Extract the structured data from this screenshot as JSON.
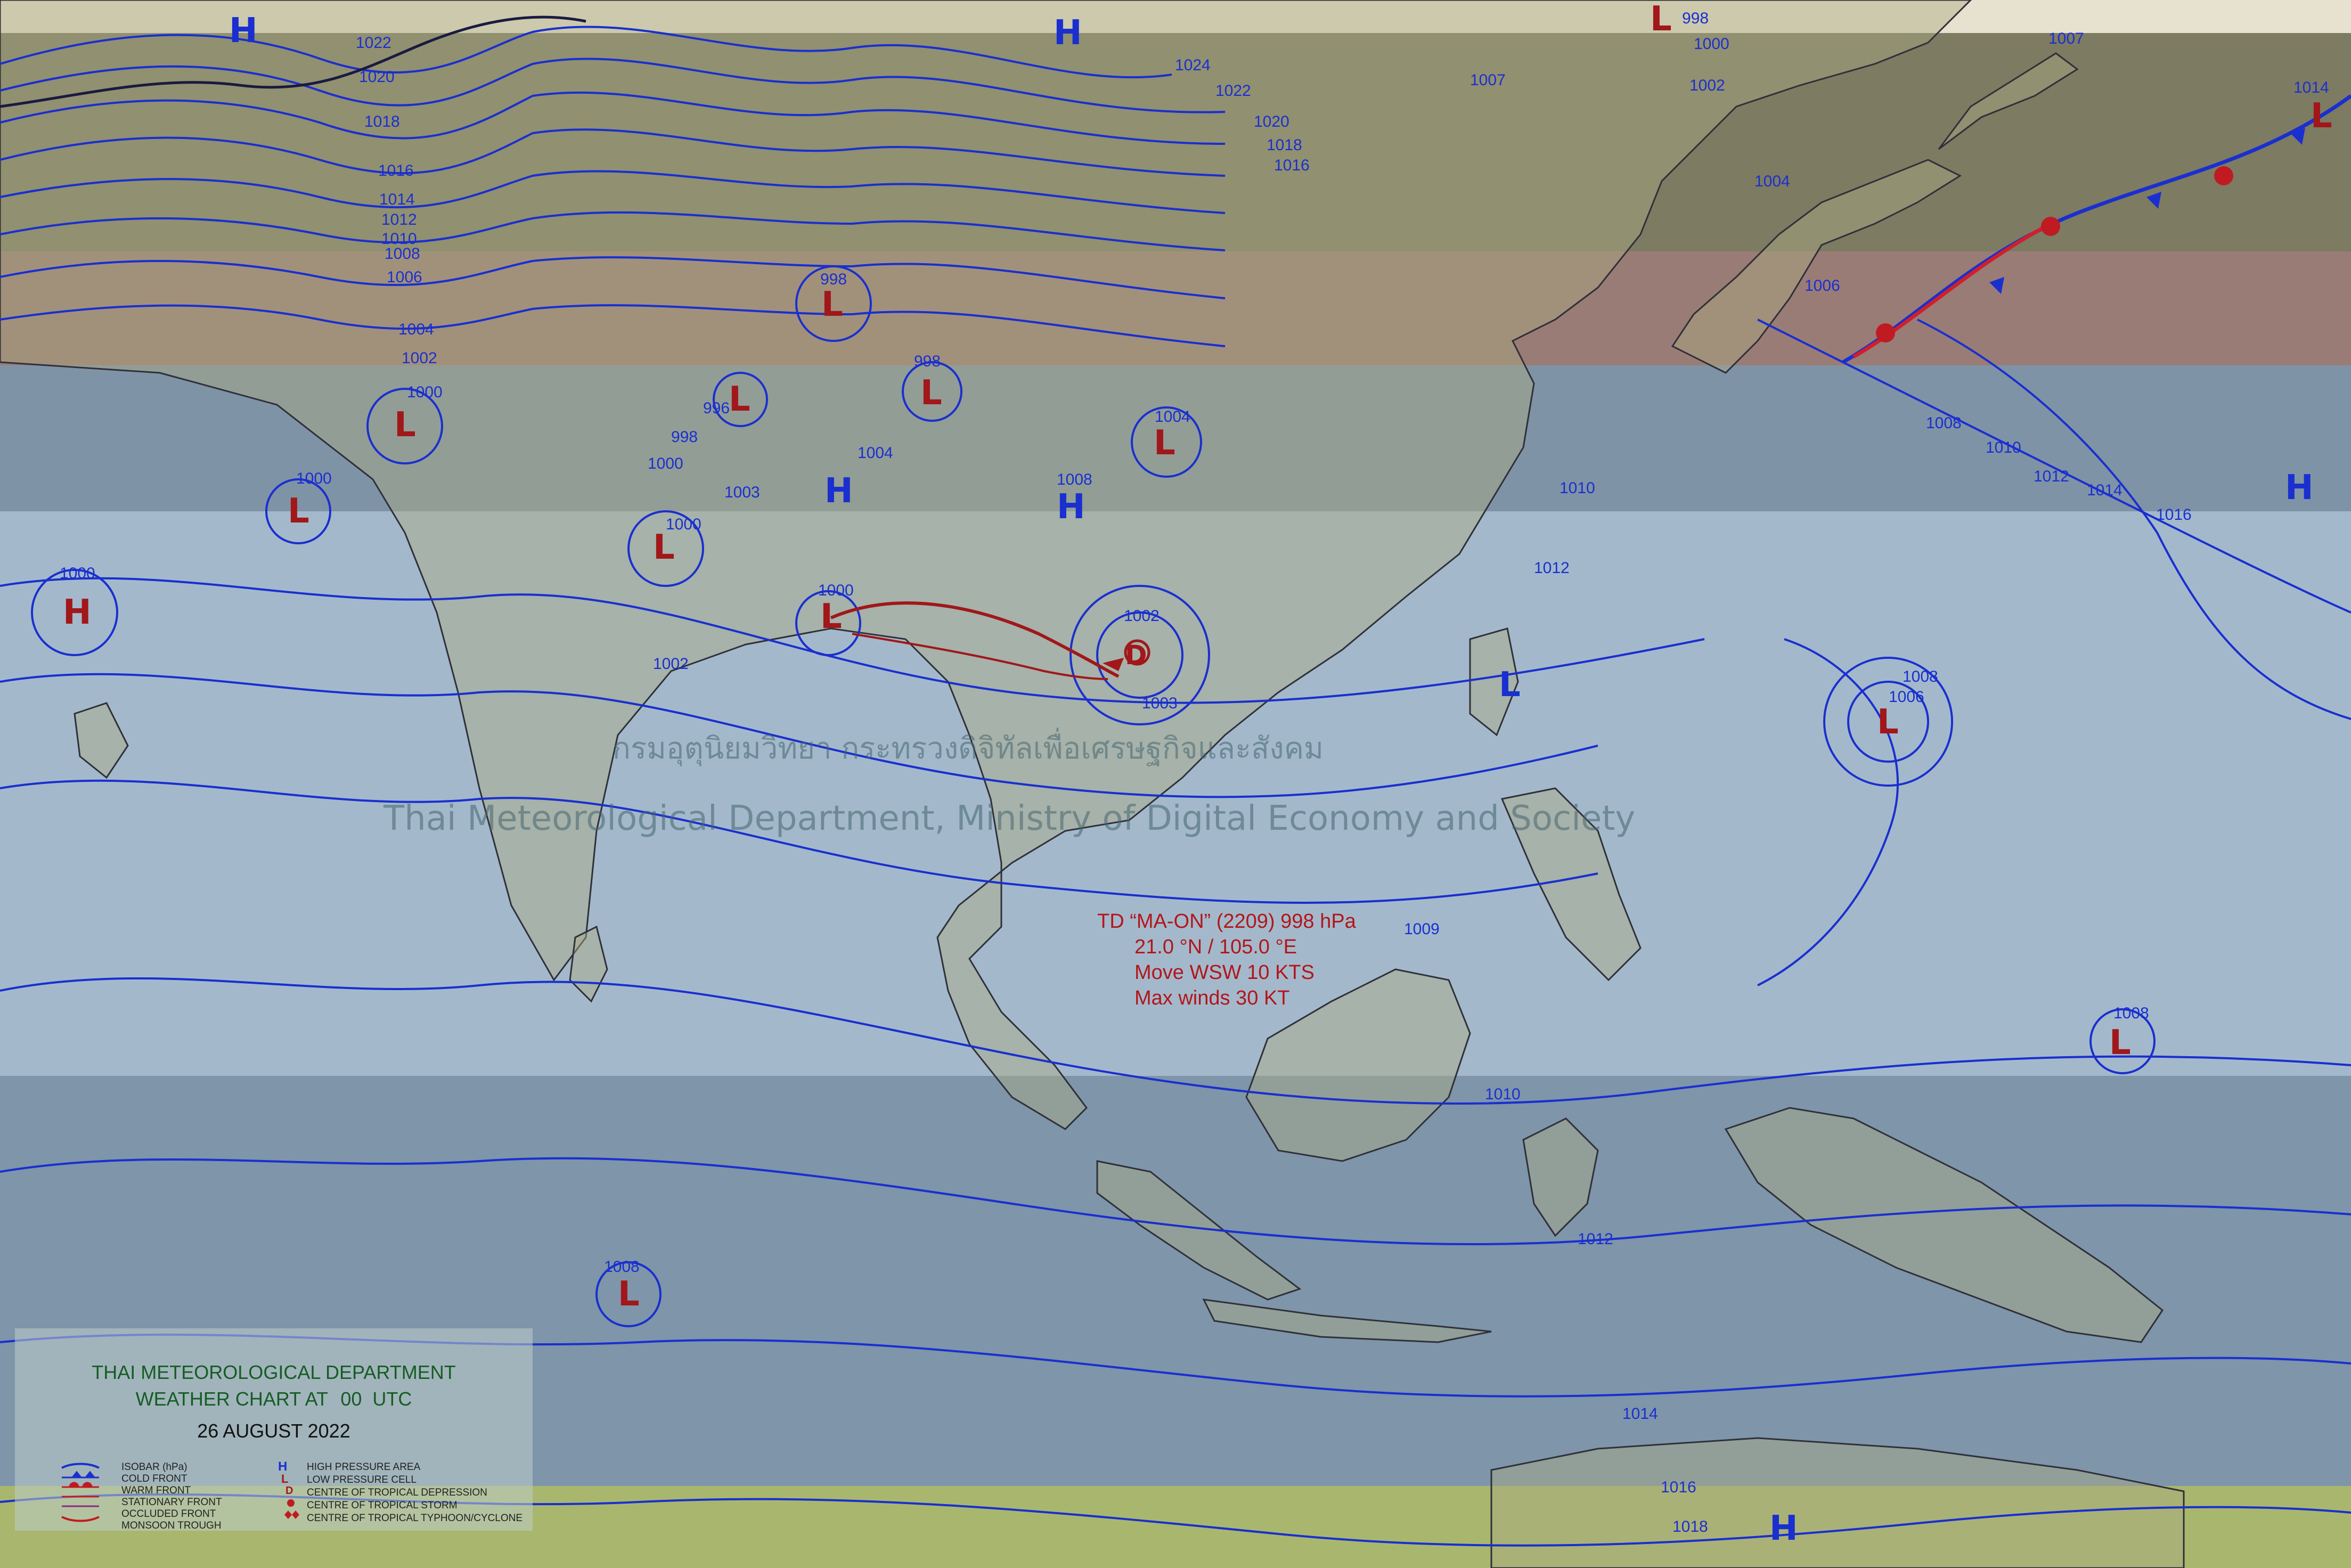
{
  "colors": {
    "isobar": "#1a2fcf",
    "high": "#1a2fcf",
    "low": "#a1171a",
    "depression": "#a1171a",
    "monsoon_trough": "#a1171a",
    "band_top": "#7d7a60",
    "band_brown": "#9b7f78",
    "band_grey": "#6f8294",
    "band_light": "#9fb6c8",
    "band_lower": "#7f97ad",
    "band_bottom": "#a8b86c",
    "legend_title": "#155c24"
  },
  "watermark": {
    "thai": "กรมอุตุนิยมวิทยา กระทรวงดิจิทัลเพื่อเศรษฐกิจและสังคม",
    "english": "Thai Meteorological Department, Ministry of Digital Economy and Society"
  },
  "pressure_centers": [
    {
      "type": "H",
      "label": "H"
    },
    {
      "type": "H",
      "label": "H"
    },
    {
      "type": "L",
      "label": "L"
    },
    {
      "type": "L",
      "label": "L"
    },
    {
      "type": "L",
      "label": "L"
    },
    {
      "type": "L",
      "label": "L"
    },
    {
      "type": "L",
      "label": "L"
    },
    {
      "type": "L",
      "label": "L"
    },
    {
      "type": "H",
      "label": "H"
    },
    {
      "type": "H",
      "label": "H"
    },
    {
      "type": "L",
      "label": "L"
    },
    {
      "type": "L",
      "label": "L"
    },
    {
      "type": "L",
      "label": "L"
    },
    {
      "type": "L",
      "label": "L"
    },
    {
      "type": "D",
      "label": "D"
    },
    {
      "type": "H",
      "label": "H"
    },
    {
      "type": "L",
      "label": "L"
    },
    {
      "type": "H",
      "label": "H"
    },
    {
      "type": "L",
      "label": "L"
    },
    {
      "type": "L",
      "label": "L"
    },
    {
      "type": "H",
      "label": "H"
    },
    {
      "type": "L",
      "label": "L"
    }
  ],
  "isobar_labels": [
    "1022",
    "1020",
    "1018",
    "1016",
    "1014",
    "1012",
    "1010",
    "1008",
    "1006",
    "1004",
    "1002",
    "1024",
    "1022",
    "1020",
    "1018",
    "1016",
    "998",
    "998",
    "996",
    "998",
    "1000",
    "1003",
    "1000",
    "1000",
    "1000",
    "1000",
    "1004",
    "1008",
    "1004",
    "1000",
    "1002",
    "1003",
    "1002",
    "1007",
    "1002",
    "1000",
    "998",
    "1004",
    "1006",
    "1007",
    "1014",
    "1008",
    "1010",
    "1010",
    "1012",
    "1014",
    "1016",
    "1012",
    "1008",
    "1006",
    "1009",
    "1008",
    "1010",
    "1012",
    "1014",
    "1008",
    "1016",
    "1018"
  ],
  "storm_info": {
    "name": "TD “MA-ON” (2209) 998 hPa",
    "position": "21.0 °N / 105.0 °E",
    "movement": "Move WSW 10 KTS",
    "max_winds": "Max winds 30 KT"
  },
  "legend": {
    "title_line1": "THAI METEOROLOGICAL DEPARTMENT",
    "title_line2_prefix": "WEATHER CHART AT",
    "title_line2_time": "00",
    "title_line2_suffix": "UTC",
    "date": "26 AUGUST 2022",
    "keys_left": [
      "ISOBAR (hPa)",
      "COLD FRONT",
      "WARM FRONT",
      "STATIONARY FRONT",
      "OCCLUDED FRONT",
      "MONSOON TROUGH"
    ],
    "keys_right": [
      "HIGH PRESSURE AREA",
      "LOW PRESSURE CELL",
      "CENTRE OF TROPICAL DEPRESSION",
      "CENTRE OF TROPICAL STORM",
      "CENTRE OF TROPICAL TYPHOON/CYCLONE"
    ],
    "key_symbols": [
      "H",
      "L",
      "D"
    ]
  }
}
